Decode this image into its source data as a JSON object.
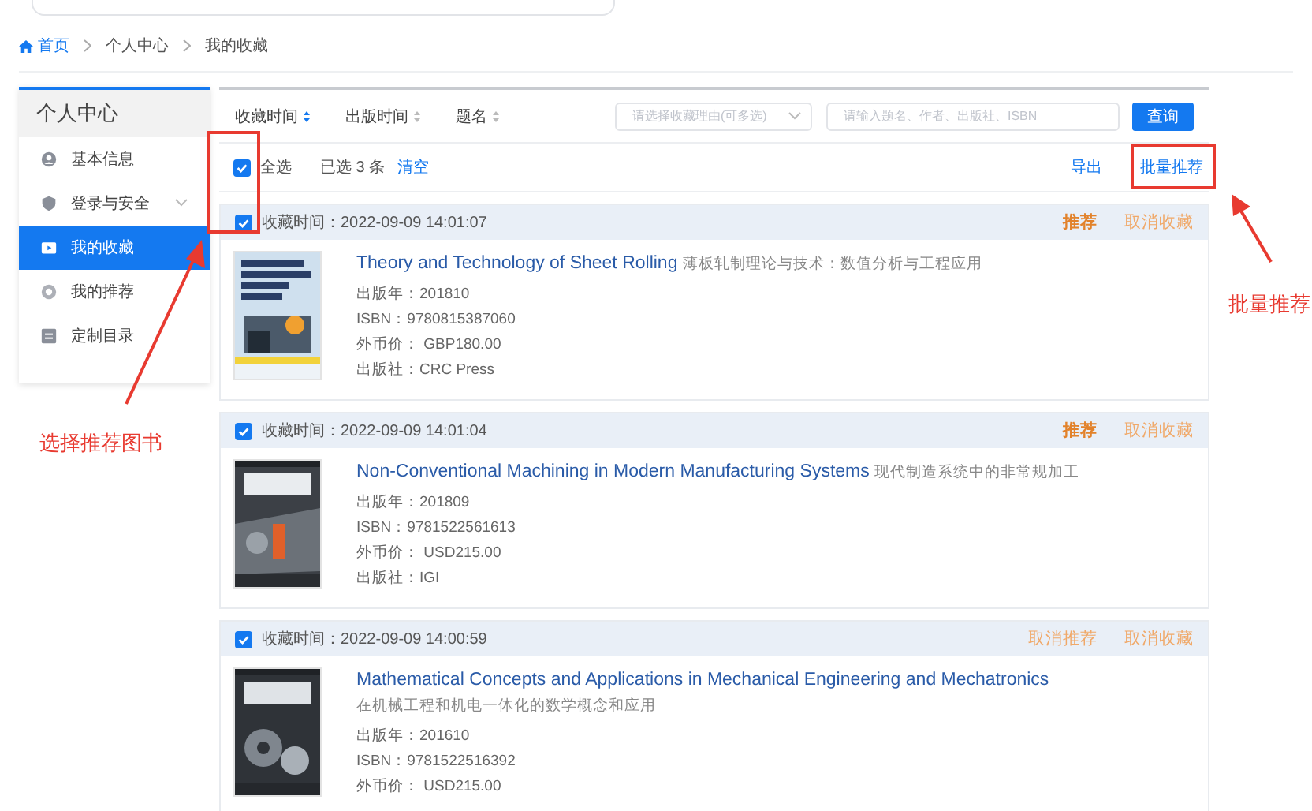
{
  "breadcrumb": [
    {
      "label": "首页",
      "kind": "home"
    },
    {
      "label": "个人中心",
      "kind": "link"
    },
    {
      "label": "我的收藏",
      "kind": "current"
    }
  ],
  "sidebar": {
    "title": "个人中心",
    "items": [
      {
        "label": "基本信息",
        "kind": "user",
        "selected": false,
        "expandable": false
      },
      {
        "label": "登录与安全",
        "kind": "shield",
        "selected": false,
        "expandable": true
      },
      {
        "label": "我的收藏",
        "kind": "folder",
        "selected": true,
        "expandable": false
      },
      {
        "label": "我的推荐",
        "kind": "thumb",
        "selected": false,
        "expandable": false
      },
      {
        "label": "定制目录",
        "kind": "list",
        "selected": false,
        "expandable": false
      }
    ]
  },
  "filters": {
    "sort": [
      {
        "label": "收藏时间",
        "selected": true
      },
      {
        "label": "出版时间",
        "selected": false
      },
      {
        "label": "题名",
        "selected": false
      }
    ],
    "reason_select": {
      "placeholder": "请选择收藏理由(可多选)"
    },
    "search": {
      "placeholder": "请输入题名、作者、出版社、ISBN"
    },
    "query_button": "查询"
  },
  "toolbar": {
    "select_all": {
      "label": "全选",
      "checked": true
    },
    "selected_count": "已选 3 条",
    "clear": "清空",
    "export": "导出",
    "batch_recommend": "批量推荐"
  },
  "books": [
    {
      "checked": true,
      "time": "收藏时间：2022-09-09 14:01:07",
      "title": "Theory and Technology of Sheet Rolling",
      "subtitle": "薄板轧制理论与技术：数值分析与工程应用",
      "meta": [
        "出版年：201810",
        "ISBN：9780815387060",
        "外币价：  GBP180.00",
        "出版社：CRC Press"
      ],
      "actions": [
        {
          "label": "推荐",
          "kind": "recommend"
        },
        {
          "label": "取消收藏",
          "kind": "unfavorite"
        }
      ]
    },
    {
      "checked": true,
      "time": "收藏时间：2022-09-09 14:01:04",
      "title": "Non-Conventional Machining in Modern Manufacturing Systems",
      "subtitle": "现代制造系统中的非常规加工",
      "meta": [
        "出版年：201809",
        "ISBN：9781522561613",
        "外币价：  USD215.00",
        "出版社：IGI"
      ],
      "actions": [
        {
          "label": "推荐",
          "kind": "recommend"
        },
        {
          "label": "取消收藏",
          "kind": "unfavorite"
        }
      ]
    },
    {
      "checked": true,
      "time": "收藏时间：2022-09-09 14:00:59",
      "title": "Mathematical Concepts and Applications in Mechanical Engineering and Mechatronics",
      "subtitle": "在机械工程和机电一体化的数学概念和应用",
      "meta": [
        "出版年：201610",
        "ISBN：9781522516392",
        "外币价：  USD215.00"
      ],
      "actions": [
        {
          "label": "取消推荐",
          "kind": "unrecommend"
        },
        {
          "label": "取消收藏",
          "kind": "unfavorite"
        }
      ]
    }
  ],
  "annotations": [
    {
      "label": "选择推荐图书",
      "kind": "left"
    },
    {
      "label": "批量推荐",
      "kind": "right"
    }
  ]
}
